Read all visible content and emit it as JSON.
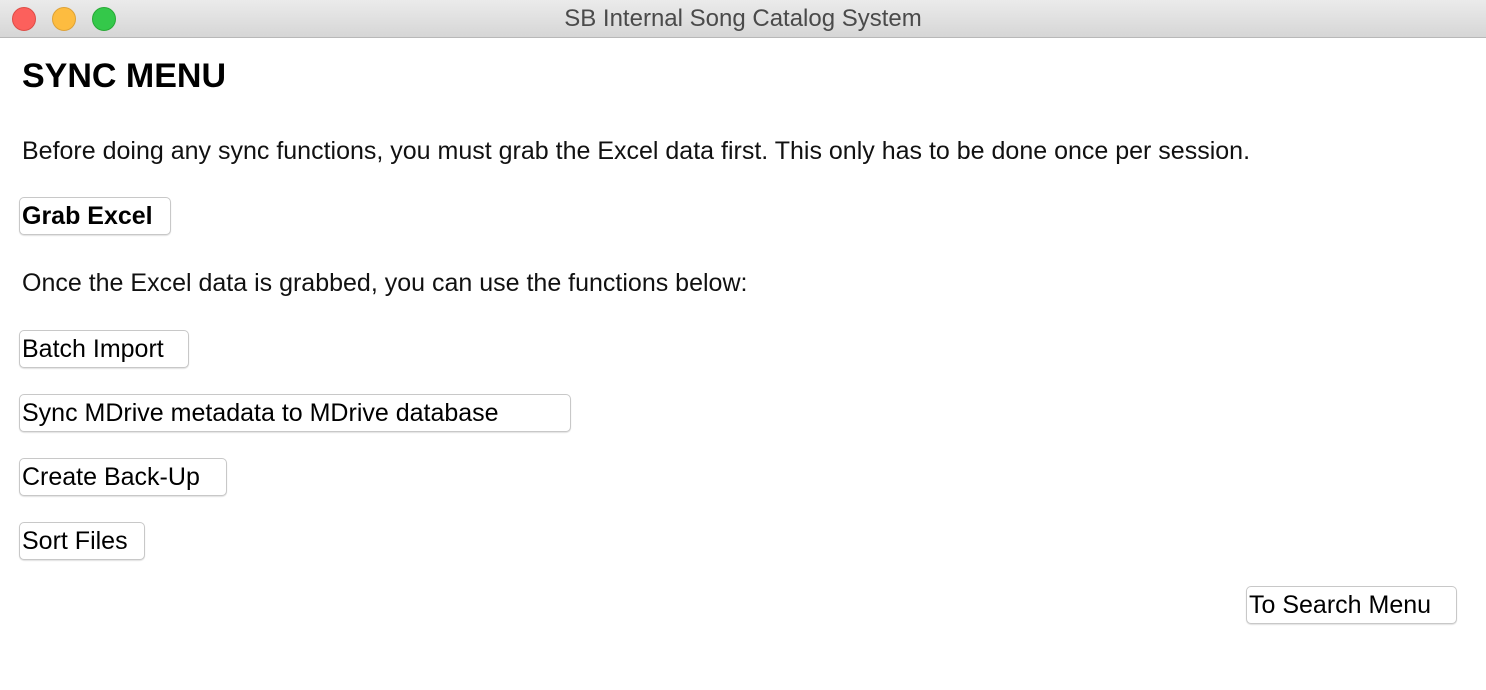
{
  "window": {
    "title": "SB Internal Song Catalog System"
  },
  "main": {
    "heading": "SYNC MENU",
    "instruction": "Before doing any sync functions, you must grab the Excel data first. This only has to be done once per session.",
    "grab_excel_label": "Grab Excel",
    "functions_intro": "Once the Excel data is grabbed, you can use the functions below:",
    "buttons": [
      {
        "label": "Batch Import"
      },
      {
        "label": "Sync MDrive metadata to MDrive database"
      },
      {
        "label": "Create Back-Up"
      },
      {
        "label": "Sort Files"
      }
    ],
    "to_search_label": "To Search Menu"
  }
}
